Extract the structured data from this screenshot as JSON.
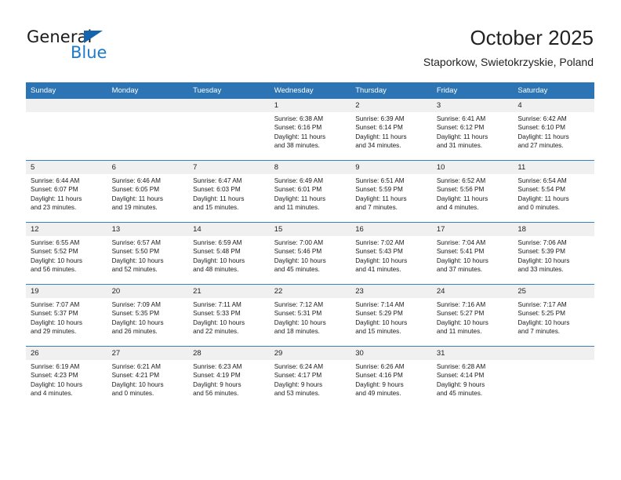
{
  "brand": {
    "word1": "General",
    "word2": "Blue",
    "triangle_color": "#1565AE",
    "blue_color": "#1E7BC8"
  },
  "header": {
    "title": "October 2025",
    "subtitle": "Staporkow, Swietokrzyskie, Poland"
  },
  "calendar": {
    "header_color": "#2C74B3",
    "daystrip_color": "#F0F0F0",
    "weekdays": [
      "Sunday",
      "Monday",
      "Tuesday",
      "Wednesday",
      "Thursday",
      "Friday",
      "Saturday"
    ],
    "weeks": [
      [
        {
          "day": "",
          "lines": []
        },
        {
          "day": "",
          "lines": []
        },
        {
          "day": "",
          "lines": []
        },
        {
          "day": "1",
          "lines": [
            "Sunrise: 6:38 AM",
            "Sunset: 6:16 PM",
            "Daylight: 11 hours",
            "and 38 minutes."
          ]
        },
        {
          "day": "2",
          "lines": [
            "Sunrise: 6:39 AM",
            "Sunset: 6:14 PM",
            "Daylight: 11 hours",
            "and 34 minutes."
          ]
        },
        {
          "day": "3",
          "lines": [
            "Sunrise: 6:41 AM",
            "Sunset: 6:12 PM",
            "Daylight: 11 hours",
            "and 31 minutes."
          ]
        },
        {
          "day": "4",
          "lines": [
            "Sunrise: 6:42 AM",
            "Sunset: 6:10 PM",
            "Daylight: 11 hours",
            "and 27 minutes."
          ]
        }
      ],
      [
        {
          "day": "5",
          "lines": [
            "Sunrise: 6:44 AM",
            "Sunset: 6:07 PM",
            "Daylight: 11 hours",
            "and 23 minutes."
          ]
        },
        {
          "day": "6",
          "lines": [
            "Sunrise: 6:46 AM",
            "Sunset: 6:05 PM",
            "Daylight: 11 hours",
            "and 19 minutes."
          ]
        },
        {
          "day": "7",
          "lines": [
            "Sunrise: 6:47 AM",
            "Sunset: 6:03 PM",
            "Daylight: 11 hours",
            "and 15 minutes."
          ]
        },
        {
          "day": "8",
          "lines": [
            "Sunrise: 6:49 AM",
            "Sunset: 6:01 PM",
            "Daylight: 11 hours",
            "and 11 minutes."
          ]
        },
        {
          "day": "9",
          "lines": [
            "Sunrise: 6:51 AM",
            "Sunset: 5:59 PM",
            "Daylight: 11 hours",
            "and 7 minutes."
          ]
        },
        {
          "day": "10",
          "lines": [
            "Sunrise: 6:52 AM",
            "Sunset: 5:56 PM",
            "Daylight: 11 hours",
            "and 4 minutes."
          ]
        },
        {
          "day": "11",
          "lines": [
            "Sunrise: 6:54 AM",
            "Sunset: 5:54 PM",
            "Daylight: 11 hours",
            "and 0 minutes."
          ]
        }
      ],
      [
        {
          "day": "12",
          "lines": [
            "Sunrise: 6:55 AM",
            "Sunset: 5:52 PM",
            "Daylight: 10 hours",
            "and 56 minutes."
          ]
        },
        {
          "day": "13",
          "lines": [
            "Sunrise: 6:57 AM",
            "Sunset: 5:50 PM",
            "Daylight: 10 hours",
            "and 52 minutes."
          ]
        },
        {
          "day": "14",
          "lines": [
            "Sunrise: 6:59 AM",
            "Sunset: 5:48 PM",
            "Daylight: 10 hours",
            "and 48 minutes."
          ]
        },
        {
          "day": "15",
          "lines": [
            "Sunrise: 7:00 AM",
            "Sunset: 5:46 PM",
            "Daylight: 10 hours",
            "and 45 minutes."
          ]
        },
        {
          "day": "16",
          "lines": [
            "Sunrise: 7:02 AM",
            "Sunset: 5:43 PM",
            "Daylight: 10 hours",
            "and 41 minutes."
          ]
        },
        {
          "day": "17",
          "lines": [
            "Sunrise: 7:04 AM",
            "Sunset: 5:41 PM",
            "Daylight: 10 hours",
            "and 37 minutes."
          ]
        },
        {
          "day": "18",
          "lines": [
            "Sunrise: 7:06 AM",
            "Sunset: 5:39 PM",
            "Daylight: 10 hours",
            "and 33 minutes."
          ]
        }
      ],
      [
        {
          "day": "19",
          "lines": [
            "Sunrise: 7:07 AM",
            "Sunset: 5:37 PM",
            "Daylight: 10 hours",
            "and 29 minutes."
          ]
        },
        {
          "day": "20",
          "lines": [
            "Sunrise: 7:09 AM",
            "Sunset: 5:35 PM",
            "Daylight: 10 hours",
            "and 26 minutes."
          ]
        },
        {
          "day": "21",
          "lines": [
            "Sunrise: 7:11 AM",
            "Sunset: 5:33 PM",
            "Daylight: 10 hours",
            "and 22 minutes."
          ]
        },
        {
          "day": "22",
          "lines": [
            "Sunrise: 7:12 AM",
            "Sunset: 5:31 PM",
            "Daylight: 10 hours",
            "and 18 minutes."
          ]
        },
        {
          "day": "23",
          "lines": [
            "Sunrise: 7:14 AM",
            "Sunset: 5:29 PM",
            "Daylight: 10 hours",
            "and 15 minutes."
          ]
        },
        {
          "day": "24",
          "lines": [
            "Sunrise: 7:16 AM",
            "Sunset: 5:27 PM",
            "Daylight: 10 hours",
            "and 11 minutes."
          ]
        },
        {
          "day": "25",
          "lines": [
            "Sunrise: 7:17 AM",
            "Sunset: 5:25 PM",
            "Daylight: 10 hours",
            "and 7 minutes."
          ]
        }
      ],
      [
        {
          "day": "26",
          "lines": [
            "Sunrise: 6:19 AM",
            "Sunset: 4:23 PM",
            "Daylight: 10 hours",
            "and 4 minutes."
          ]
        },
        {
          "day": "27",
          "lines": [
            "Sunrise: 6:21 AM",
            "Sunset: 4:21 PM",
            "Daylight: 10 hours",
            "and 0 minutes."
          ]
        },
        {
          "day": "28",
          "lines": [
            "Sunrise: 6:23 AM",
            "Sunset: 4:19 PM",
            "Daylight: 9 hours",
            "and 56 minutes."
          ]
        },
        {
          "day": "29",
          "lines": [
            "Sunrise: 6:24 AM",
            "Sunset: 4:17 PM",
            "Daylight: 9 hours",
            "and 53 minutes."
          ]
        },
        {
          "day": "30",
          "lines": [
            "Sunrise: 6:26 AM",
            "Sunset: 4:16 PM",
            "Daylight: 9 hours",
            "and 49 minutes."
          ]
        },
        {
          "day": "31",
          "lines": [
            "Sunrise: 6:28 AM",
            "Sunset: 4:14 PM",
            "Daylight: 9 hours",
            "and 45 minutes."
          ]
        },
        {
          "day": "",
          "lines": []
        }
      ]
    ]
  }
}
